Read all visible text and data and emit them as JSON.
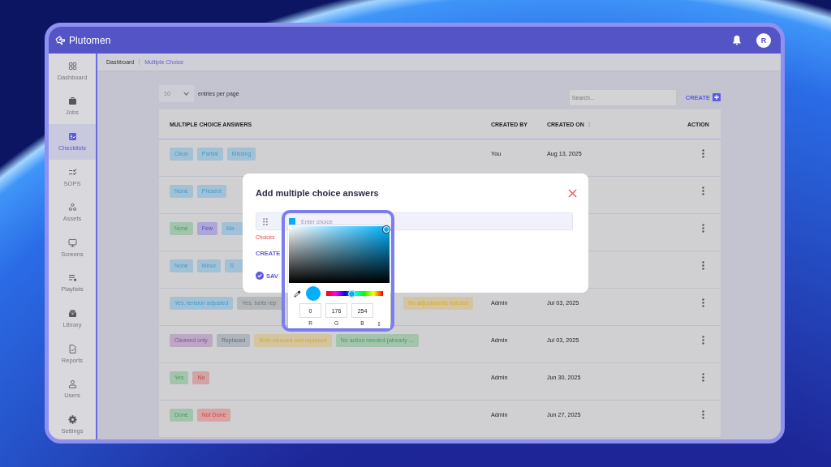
{
  "header": {
    "logo": "Plutomen",
    "avatar": "R"
  },
  "sidebar": {
    "items": [
      {
        "label": "Dashboard",
        "selected": false
      },
      {
        "label": "Jobs",
        "selected": false
      },
      {
        "label": "Checklists",
        "selected": true
      },
      {
        "label": "SOPS",
        "selected": false
      },
      {
        "label": "Assets",
        "selected": false
      },
      {
        "label": "Screens",
        "selected": false
      },
      {
        "label": "Playlists",
        "selected": false
      },
      {
        "label": "Library",
        "selected": false
      },
      {
        "label": "Reports",
        "selected": false
      },
      {
        "label": "Users",
        "selected": false
      },
      {
        "label": "Settings",
        "selected": false
      }
    ]
  },
  "breadcrumb": [
    {
      "label": "Dashboard",
      "selected": false
    },
    {
      "label": "Multiple Choice",
      "selected": true
    }
  ],
  "toolbar": {
    "page_size": "10",
    "page_size_label": "entries per page",
    "search_placeholder": "Search...",
    "create": "CREATE"
  },
  "table": {
    "columns": [
      {
        "label": "MULTIPLE CHOICE ANSWERS",
        "sortable": false
      },
      {
        "label": "CREATED BY",
        "sortable": false
      },
      {
        "label": "CREATED ON",
        "sortable": true
      },
      {
        "label": "ACTION",
        "sortable": false
      }
    ],
    "rows": [
      {
        "answers": [
          {
            "text": "Clear",
            "color": "#a3c1d4",
            "cut": false
          },
          {
            "text": "Partial",
            "color": "#a3c1d4",
            "cut": false
          },
          {
            "text": "Missing",
            "color": "#a3c1d4",
            "cut": false
          }
        ],
        "created_by": "You",
        "created_on": "Aug 13, 2025"
      },
      {
        "answers": [
          {
            "text": "None",
            "color": "#a3c1d4",
            "cut": false
          },
          {
            "text": "Present",
            "color": "#a3c1d4",
            "cut": false
          }
        ]
      },
      {
        "answers": [
          {
            "text": "None",
            "color": "#a4c3ac",
            "cut": false
          },
          {
            "text": "Few",
            "color": "#aca7d4",
            "cut": false
          },
          {
            "text": "Ma",
            "color": "#a3c1d4",
            "cut": true
          }
        ]
      },
      {
        "answers": [
          {
            "text": "None",
            "color": "#a3c1d4",
            "cut": false
          },
          {
            "text": "Minor",
            "color": "#a3c1d4",
            "cut": false
          },
          {
            "text": "S",
            "color": "#a3c1d4",
            "cut": true
          }
        ]
      },
      {
        "answers": [
          {
            "text": "Yes, tension adjusted",
            "color": "#a3c1d4",
            "cut": false
          },
          {
            "text": "Yes, belts rep",
            "color": "#b4b6b9",
            "cut": true
          },
          {
            "text": "No adjustments needed",
            "color": "#d2c5a0",
            "cut": false
          }
        ],
        "created_by": "Admin",
        "created_on": "Jul 03, 2025"
      },
      {
        "answers": [
          {
            "text": "Cleaned only",
            "color": "#bca8c2",
            "cut": false
          },
          {
            "text": "Replaced",
            "color": "#aeb4b9",
            "cut": false
          },
          {
            "text": "Both cleaned and replaced",
            "color": "#d2c5a0",
            "cut": false
          },
          {
            "text": "No action needed (already ...",
            "color": "#a4c3ac",
            "cut": false
          }
        ],
        "created_by": "Admin",
        "created_on": "Jul 03, 2025"
      },
      {
        "answers": [
          {
            "text": "Yes",
            "color": "#a4c3ac",
            "cut": false
          },
          {
            "text": "No",
            "color": "#cea4a5",
            "cut": false
          }
        ],
        "created_by": "Admin",
        "created_on": "Jun 30, 2025"
      },
      {
        "answers": [
          {
            "text": "Done",
            "color": "#a4c3ac",
            "cut": false
          },
          {
            "text": "Not Done",
            "color": "#d6a4a5",
            "cut": false
          }
        ],
        "created_by": "Admin",
        "created_on": "Jun 27, 2025"
      }
    ]
  },
  "modal": {
    "title": "Add multiple choice answers",
    "choice": {
      "placeholder": "Enter choice",
      "color": "#00b0fe"
    },
    "error": "Choices",
    "create": "CREATE",
    "save": "SAV"
  },
  "color_picker": {
    "hue": {
      "level": 0.45
    },
    "channels": [
      {
        "label": "R",
        "value": "0"
      },
      {
        "label": "G",
        "value": "176"
      },
      {
        "label": "B",
        "value": "254"
      }
    ]
  }
}
